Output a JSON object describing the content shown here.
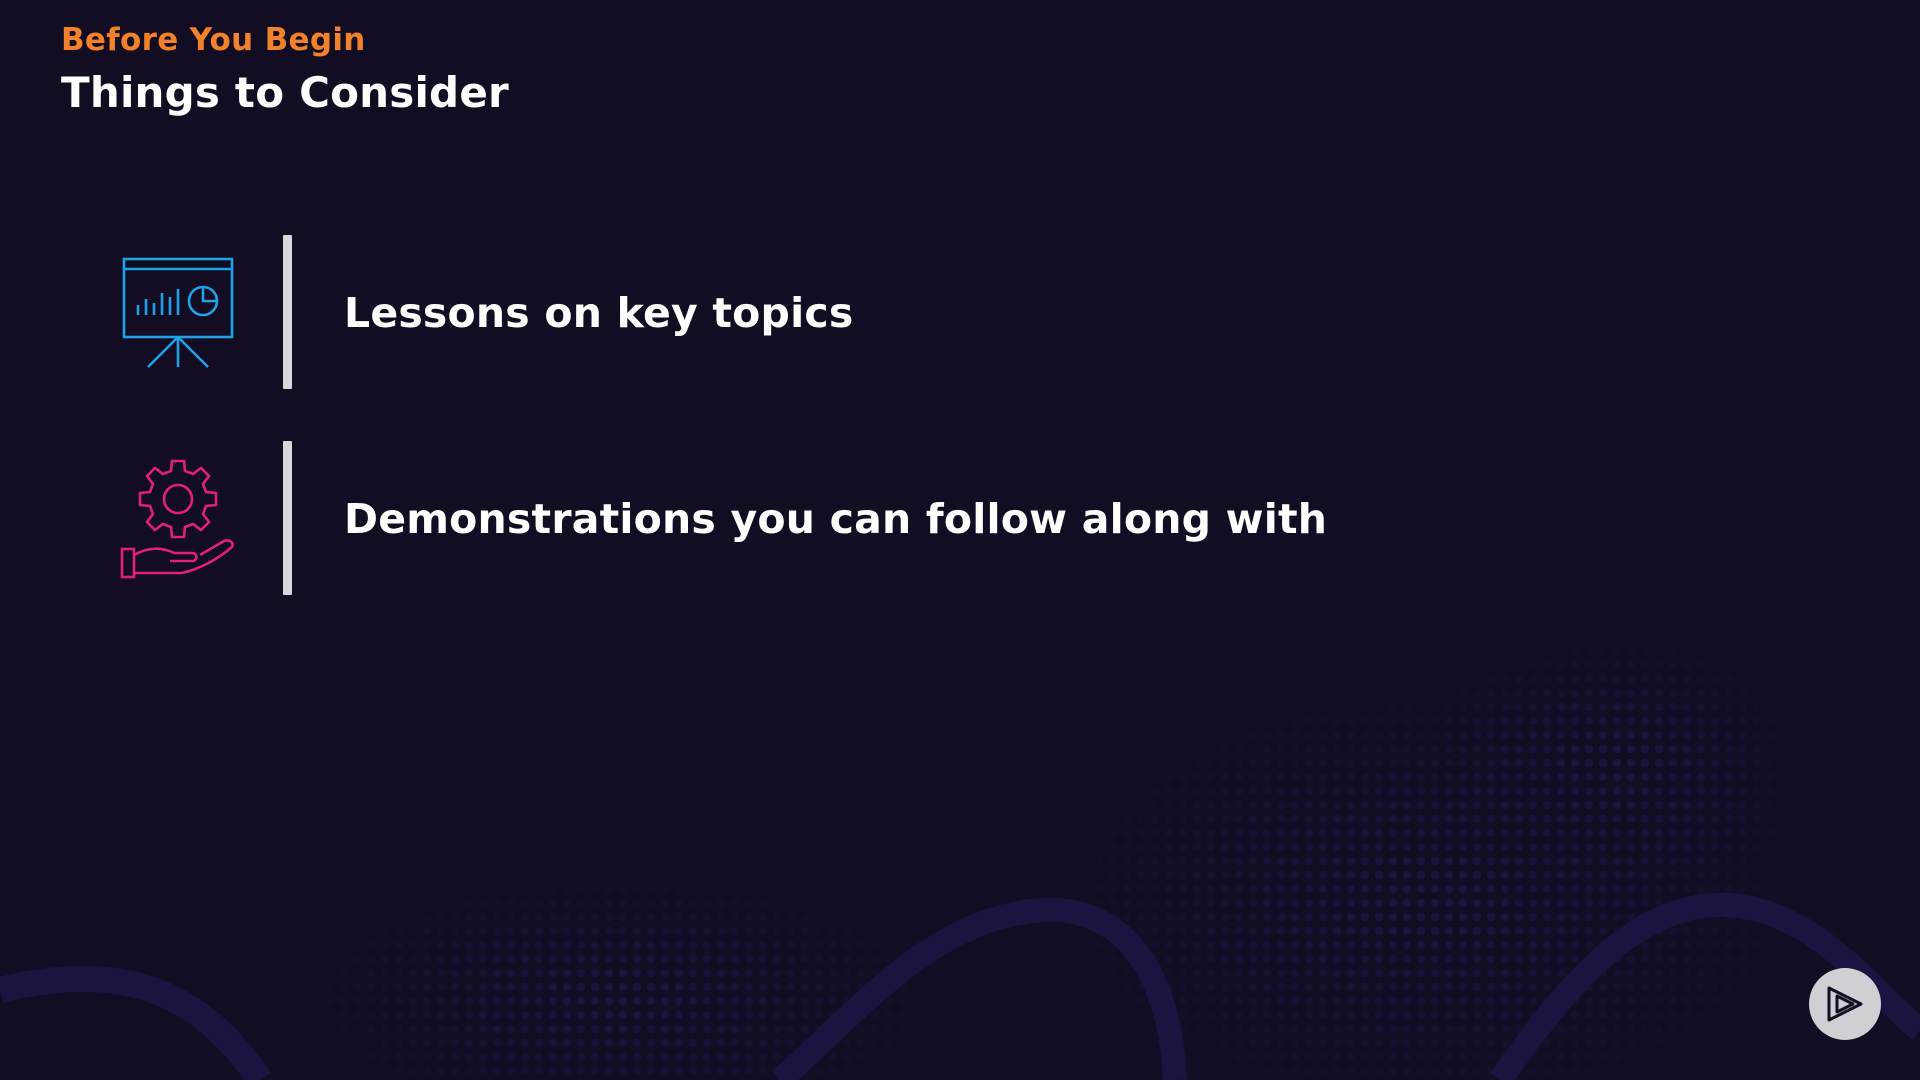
{
  "header": {
    "eyebrow": "Before You Begin",
    "title": "Things to Consider"
  },
  "items": [
    {
      "label": "Lessons on key topics",
      "icon": "presentation-chart-icon",
      "icon_color": "#1fa3e6"
    },
    {
      "label": "Demonstrations you can follow along with",
      "icon": "gear-hand-icon",
      "icon_color": "#e0207a"
    }
  ],
  "colors": {
    "background": "#120d23",
    "accent": "#f1812b",
    "text": "#ffffff",
    "divider": "#d9d6de",
    "pattern": "#1c1440"
  },
  "player": {
    "icon": "play-logo-icon"
  }
}
